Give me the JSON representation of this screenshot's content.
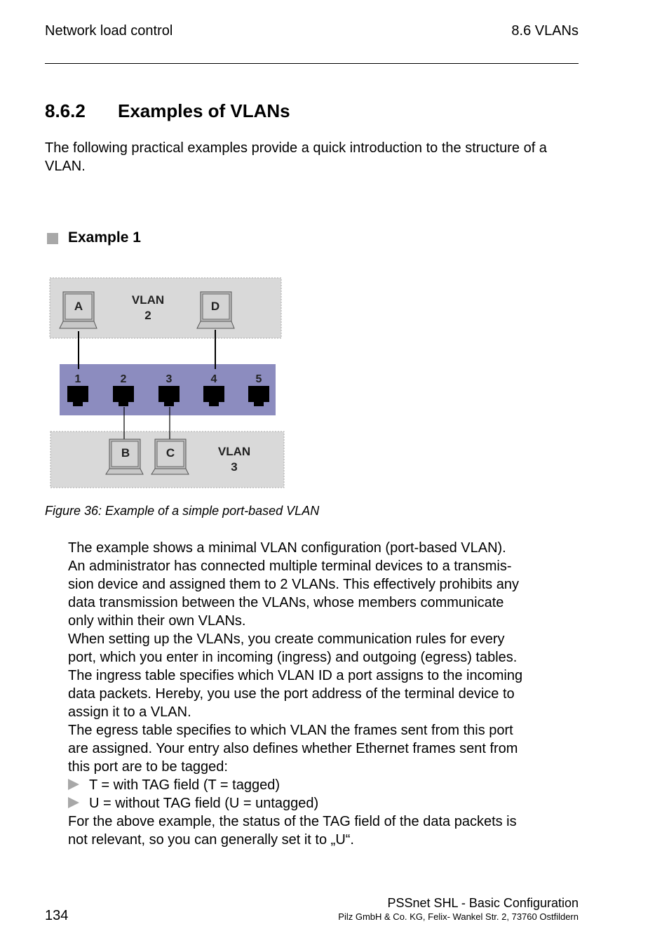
{
  "header": {
    "left": "Network load control",
    "right": "8.6  VLANs"
  },
  "section": {
    "number": "8.6.2",
    "title": "Examples of VLANs"
  },
  "intro": "The following practical examples provide a quick introduction to the structure of a VLAN.",
  "example": {
    "title": "Example 1"
  },
  "diagram": {
    "vlan_top": {
      "label_line1": "VLAN",
      "label_line2": "2"
    },
    "vlan_bottom": {
      "label_line1": "VLAN",
      "label_line2": "3"
    },
    "terminals": [
      "A",
      "D",
      "B",
      "C"
    ],
    "ports": [
      "1",
      "2",
      "3",
      "4",
      "5"
    ],
    "colors": {
      "vlan_area": "#d9d9d9",
      "switch": "#8c8cbf",
      "port": "#000000",
      "terminal_screen": "#d4d4d4"
    }
  },
  "caption": "Figure 36: Example of a simple port-based VLAN",
  "body_lines": [
    "The example shows a minimal VLAN configuration (port-based VLAN).",
    "An administrator has connected multiple terminal devices to a transmis-",
    "sion device and assigned them to 2 VLANs. This effectively prohibits any",
    "data transmission between the VLANs, whose members communicate",
    "only within their own VLANs.",
    "When setting up the VLANs, you create communication rules for every",
    "port, which you enter in incoming (ingress) and outgoing (egress) tables.",
    "The ingress table specifies which VLAN ID a port assigns to the incoming",
    "data packets. Hereby, you use the port address of the terminal device to",
    "assign it to a VLAN.",
    "The egress table specifies to which VLAN the frames sent from this port",
    "are assigned. Your entry also defines whether Ethernet frames sent from",
    "this port are to be tagged:"
  ],
  "bullets": [
    "T = with TAG field (T = tagged)",
    "U = without TAG field (U = untagged)"
  ],
  "closing_lines": [
    "For the above example, the status of the TAG field of the data packets is",
    "not relevant, so you can generally set it to „U“."
  ],
  "footer": {
    "page": "134",
    "title": "PSSnet SHL - Basic Configuration",
    "address": "Pilz GmbH & Co. KG, Felix- Wankel Str. 2, 73760 Ostfildern"
  }
}
